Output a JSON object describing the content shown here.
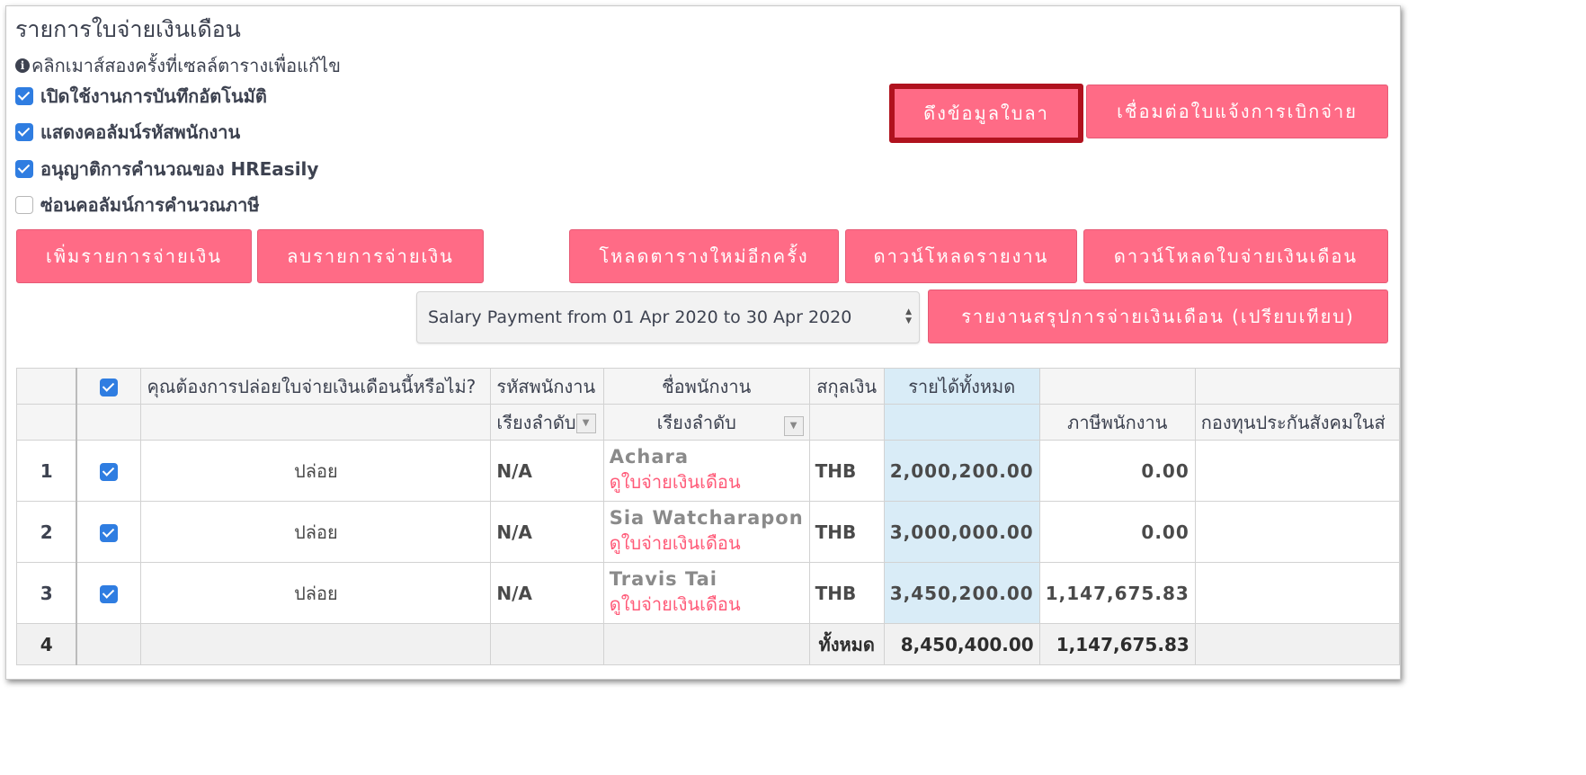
{
  "page": {
    "title": "รายการใบจ่ายเงินเดือน",
    "hint": "คลิกเมาส์สองครั้งที่เซลล์ตารางเพื่อแก้ไข"
  },
  "options": [
    {
      "label": "เปิดใช้งานการบันทึกอัตโนมัติ",
      "checked": true
    },
    {
      "label": "แสดงคอลัมน์รหัสพนักงาน",
      "checked": true
    },
    {
      "label": "อนุญาติการคำนวณของ HREasily",
      "checked": true
    },
    {
      "label": "ซ่อนคอลัมน์การคำนวณภาษี",
      "checked": false
    }
  ],
  "buttons": {
    "fetch_leave": "ดึงข้อมูลใบลา",
    "link_expense": "เชื่อมต่อใบแจ้งการเบิกจ่าย",
    "add_payment": "เพิ่มรายการจ่ายเงิน",
    "delete_payment": "ลบรายการจ่ายเงิน",
    "reload_table": "โหลดตารางใหม่อีกครั้ง",
    "download_report": "ดาวน์โหลดรายงาน",
    "download_payslip": "ดาวน์โหลดใบจ่ายเงินเดือน",
    "summary_report": "รายงานสรุปการจ่ายเงินเดือน (เปรียบเทียบ)"
  },
  "period_select": {
    "value": "Salary Payment from 01 Apr 2020 to 30 Apr 2020"
  },
  "table": {
    "headers": {
      "release": "คุณต้องการปล่อยใบจ่ายเงินเดือนนี้หรือไม่?",
      "emp_code": "รหัสพนักงาน",
      "emp_name": "ชื่อพนักงาน",
      "currency": "สกุลเงิน",
      "total_income": "รายได้ทั้งหมด",
      "emp_tax": "ภาษีพนักงาน",
      "social_fund": "กองทุนประกันสังคมในส่"
    },
    "sort_label": "เรียงลำดับ",
    "sort_label_name": "เรียงลำดับ",
    "view_payslip": "ดูใบจ่ายเงินเดือน",
    "rows": [
      {
        "no": "1",
        "release": "ปล่อย",
        "code": "N/A",
        "name": "Achara",
        "currency": "THB",
        "income": "2,000,200.00",
        "tax": "0.00"
      },
      {
        "no": "2",
        "release": "ปล่อย",
        "code": "N/A",
        "name": "Sia Watcharapon",
        "currency": "THB",
        "income": "3,000,000.00",
        "tax": "0.00"
      },
      {
        "no": "3",
        "release": "ปล่อย",
        "code": "N/A",
        "name": "Travis Tai",
        "currency": "THB",
        "income": "3,450,200.00",
        "tax": "1,147,675.83"
      }
    ],
    "total": {
      "no": "4",
      "label": "ทั้งหมด",
      "income": "8,450,400.00",
      "tax": "1,147,675.83"
    }
  }
}
